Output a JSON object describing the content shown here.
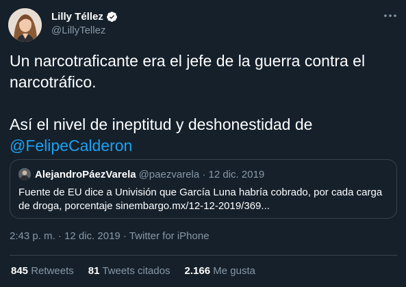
{
  "author": {
    "name": "Lilly Téllez",
    "handle": "@LillyTellez",
    "verified": true
  },
  "tweet": {
    "line1": "Un narcotraficante era el jefe de la guerra contra el narcotráfico.",
    "line2": "Así el nivel de ineptitud y deshonestidad de",
    "mention": "@FelipeCalderon"
  },
  "quote": {
    "name": "AlejandroPáezVarela",
    "meta": "@paezvarela · 12 dic. 2019",
    "text": "Fuente de EU dice a Univisión que García Luna habría cobrado, por cada carga de droga, porcentaje sinembargo.mx/12-12-2019/369..."
  },
  "timestamp": "2:43 p. m. · 12 dic. 2019 · Twitter for iPhone",
  "stats": [
    {
      "count": "845",
      "label": "Retweets"
    },
    {
      "count": "81",
      "label": "Tweets citados"
    },
    {
      "count": "2.166",
      "label": "Me gusta"
    }
  ],
  "colors": {
    "background": "#15202b",
    "accent": "#1da1f2",
    "secondary_text": "#8899a6",
    "border": "#38444d"
  },
  "icons": {
    "verified": "verified-badge-icon",
    "more": "more-horizontal-icon"
  }
}
